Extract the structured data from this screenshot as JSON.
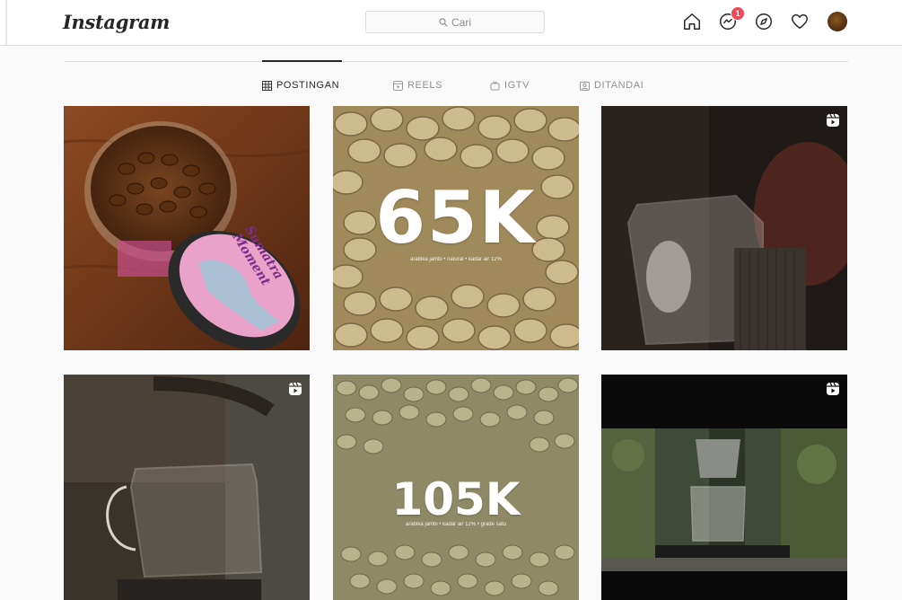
{
  "header": {
    "logo_text": "Instagram",
    "search_placeholder": "Cari",
    "messages_badge": "1",
    "icons": [
      "home-icon",
      "messenger-icon",
      "explore-icon",
      "heart-icon",
      "avatar"
    ]
  },
  "tabs": [
    {
      "label": "POSTINGAN",
      "icon": "grid-icon",
      "active": true
    },
    {
      "label": "REELS",
      "icon": "reels-icon",
      "active": false
    },
    {
      "label": "IGTV",
      "icon": "igtv-icon",
      "active": false
    },
    {
      "label": "DITANDAI",
      "icon": "tagged-icon",
      "active": false
    }
  ],
  "posts": [
    {
      "type": "photo",
      "overlay": "",
      "reel": false
    },
    {
      "type": "photo",
      "overlay": "65K",
      "caption": "arabika jambi • natural • kadar air 12%",
      "reel": false
    },
    {
      "type": "reel",
      "overlay": "",
      "reel": true
    },
    {
      "type": "reel",
      "overlay": "",
      "reel": true
    },
    {
      "type": "photo",
      "overlay": "105K",
      "caption": "arabika jambi • kadar air 12% • grade satu",
      "reel": false
    },
    {
      "type": "reel",
      "overlay": "",
      "reel": true
    }
  ],
  "jar_label": "Sumatra Moment",
  "colors": {
    "accent_badge": "#ed4956",
    "text_primary": "#262626",
    "text_muted": "#8e8e8e"
  }
}
